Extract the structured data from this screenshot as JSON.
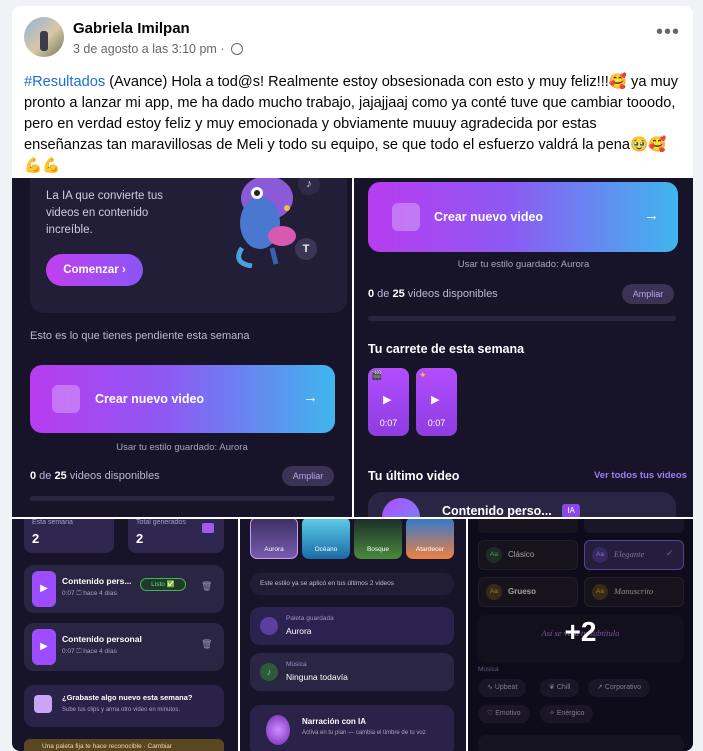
{
  "post": {
    "author": "Gabriela Imilpan",
    "timestamp": "3 de agosto a las 3:10 pm",
    "separator": "·",
    "more_icon": "more-icon",
    "text_tag": "#Resultados",
    "text_body": " (Avance) Hola a tod@s! Realmente estoy obsesionada con esto y muy feliz!!!🥰 ya muy pronto a lanzar mi app, me ha dado mucho trabajo, jajajjaaj como ya conté tuve que cambiar tooodo, pero en verdad estoy feliz y muy emocionada y obviamente muuuy agradecida por estas enseñanzas tan maravillosas de Meli y todo su equipo, se que todo el esfuerzo valdrá la pena🥹🥰💪💪"
  },
  "tile1": {
    "hero_text": "La IA que convierte tus videos en contenido increíble.",
    "cta": "Comenzar ›",
    "pending": "Esto es lo que tienes pendiente esta semana",
    "create": "Crear nuevo video",
    "style": "Usar tu estilo guardado: Aurora",
    "count_num": "0",
    "count_of": " de ",
    "count_total": "25",
    "count_suffix": " videos disponibles",
    "expand": "Ampliar",
    "t_icon": "T",
    "note_icon": "♪"
  },
  "tile2": {
    "create": "Crear nuevo video",
    "style": "Usar tu estilo guardado: Aurora",
    "count_num": "0",
    "count_of": " de ",
    "count_total": "25",
    "count_suffix": " videos disponibles",
    "expand": "Ampliar",
    "reel_title": "Tu carrete de esta semana",
    "reel_items": [
      {
        "dur": "0:07"
      },
      {
        "dur": "0:07"
      }
    ],
    "last_title": "Tu último video",
    "see_all": "Ver todos tus videos",
    "last_item": "Contenido perso...",
    "ia_badge": "IA"
  },
  "tile3": {
    "week_label": "Esta semana",
    "week_value": "2",
    "total_label": "Total generados",
    "total_value": "2",
    "items": [
      {
        "title": "Contenido pers...",
        "dur": "0:07",
        "date": "hace 4 días",
        "badge": "Listo ✅"
      },
      {
        "title": "Contenido personal",
        "dur": "0:07",
        "date": "hace 4 días",
        "badge": ""
      }
    ],
    "prompt_title": "¿Grabaste algo nuevo esta semana?",
    "prompt_sub": "Sube tus clips y arma otro video en minutos.",
    "bottom_banner": "Una paleta fija te hace reconocible · Cambiar"
  },
  "tile4": {
    "palettes": [
      "Aurora",
      "Océano",
      "Bosque",
      "Atardecer"
    ],
    "applied": "Este estilo ya se aplicó en tus últimos 2 videos",
    "palette_label": "Paleta guardada",
    "palette_value": "Aurora",
    "music_label": "Música",
    "music_value": "Ninguna todavía",
    "narr_title": "Narración con IA",
    "narr_sub": "Activa en tu plan — cambia el timbre de tu voz"
  },
  "tile5": {
    "fonts": [
      {
        "badge": "Aa",
        "name": "Clásico",
        "selected": false
      },
      {
        "badge": "Aa",
        "name": "Elegante",
        "selected": true
      },
      {
        "badge": "Aa",
        "name": "Grueso",
        "selected": false
      },
      {
        "badge": "Aa",
        "name": "Manuscrito",
        "selected": false
      }
    ],
    "preview_text": "Así se verá tu subtítulo",
    "more_count": "+2",
    "music_label": "Música",
    "chips": [
      "Upbeat",
      "Chill",
      "Corporativo",
      "Emotivo",
      "Enérgico"
    ]
  },
  "colors": {
    "accent": "#9b4dff",
    "link": "#1a6ed8",
    "bg_dark": "#17142a",
    "cyan": "#3fb6ee",
    "green_badge": "#3fb950"
  }
}
